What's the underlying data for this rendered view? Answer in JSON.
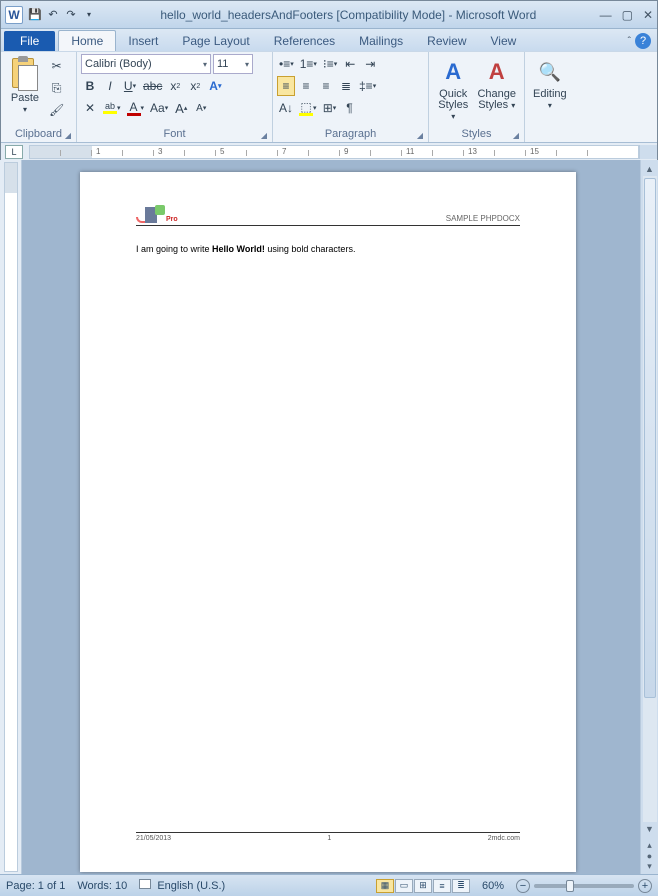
{
  "title": "hello_world_headersAndFooters [Compatibility Mode] - Microsoft Word",
  "tabs": {
    "file": "File",
    "home": "Home",
    "insert": "Insert",
    "page": "Page Layout",
    "ref": "References",
    "mail": "Mailings",
    "review": "Review",
    "view": "View"
  },
  "ribbon": {
    "clipboard": {
      "label": "Clipboard",
      "paste": "Paste"
    },
    "font": {
      "label": "Font",
      "name": "Calibri (Body)",
      "size": "11"
    },
    "paragraph": {
      "label": "Paragraph"
    },
    "styles": {
      "label": "Styles",
      "quick": "Quick Styles",
      "change": "Change Styles"
    },
    "editing": {
      "label": "Editing"
    }
  },
  "document": {
    "header_right": "SAMPLE PHPDOCX",
    "logo_text": "Pro",
    "body_pre": "I am going to write ",
    "body_bold": "Hello World!",
    "body_post": " using bold characters.",
    "footer_date": "21/05/2013",
    "footer_page": "1",
    "footer_site": "2mdc.com"
  },
  "status": {
    "page": "Page: 1 of 1",
    "words": "Words: 10",
    "lang": "English (U.S.)",
    "zoom": "60%"
  }
}
